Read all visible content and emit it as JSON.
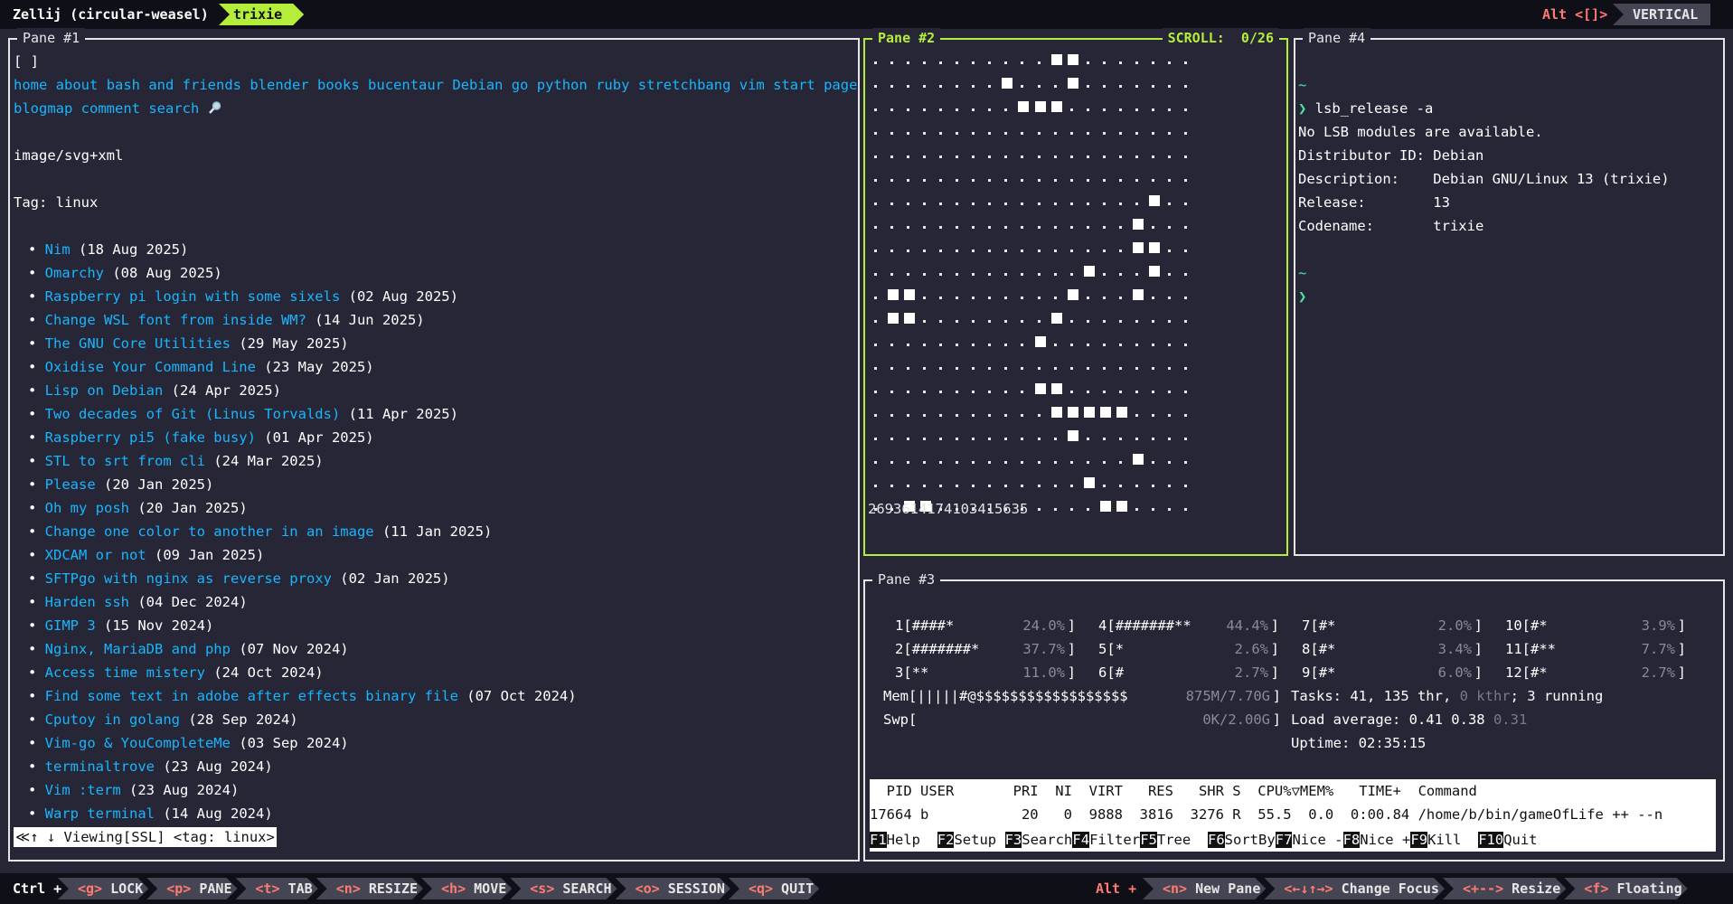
{
  "topbar": {
    "session": "Zellij (circular-weasel)",
    "tab": "trixie",
    "alt_hint": "Alt <[]>",
    "layout": "VERTICAL"
  },
  "panes": {
    "p1": {
      "title": "Pane #1"
    },
    "p2": {
      "title": "Pane #2",
      "scroll": "SCROLL:  0/26"
    },
    "p3": {
      "title": "Pane #3"
    },
    "p4": {
      "title": "Pane #4"
    }
  },
  "browser": {
    "top": "[ ]",
    "nav": [
      "home",
      "about",
      "bash and friends",
      "blender",
      "books",
      "bucentaur",
      "Debian",
      "go",
      "python",
      "ruby",
      "stretchbang",
      "vim",
      "start page"
    ],
    "nav2": [
      "blogmap",
      "comment",
      "search"
    ],
    "search_icon": "magnifier-icon",
    "mime": "image/svg+xml",
    "tag": "Tag: linux",
    "posts": [
      {
        "title": "Nim",
        "date": " (18 Aug 2025)"
      },
      {
        "title": "Omarchy",
        "date": " (08 Aug 2025)"
      },
      {
        "title": "Raspberry pi login with some sixels",
        "date": " (02 Aug 2025)"
      },
      {
        "title": "Change WSL font from inside WM?",
        "date": " (14 Jun 2025)"
      },
      {
        "title": "The GNU Core Utilities",
        "date": " (29 May 2025)"
      },
      {
        "title": "Oxidise Your Command Line",
        "date": " (23 May 2025)"
      },
      {
        "title": "Lisp on Debian",
        "date": " (24 Apr 2025)"
      },
      {
        "title": "Two decades of Git (Linus Torvalds)",
        "date": " (11 Apr 2025)"
      },
      {
        "title": "Raspberry pi5 (fake busy)",
        "date": " (01 Apr 2025)"
      },
      {
        "title": "STL to srt from cli",
        "date": " (24 Mar 2025)"
      },
      {
        "title": "Please",
        "date": " (20 Jan 2025)"
      },
      {
        "title": "Oh my posh",
        "date": " (20 Jan 2025)"
      },
      {
        "title": "Change one color to another in an image",
        "date": " (11 Jan 2025)"
      },
      {
        "title": "XDCAM or not",
        "date": " (09 Jan 2025)"
      },
      {
        "title": "SFTPgo with nginx as reverse proxy",
        "date": " (02 Jan 2025)"
      },
      {
        "title": "Harden ssh",
        "date": " (04 Dec 2024)"
      },
      {
        "title": "GIMP 3",
        "date": " (15 Nov 2024)"
      },
      {
        "title": "Nginx, MariaDB and php",
        "date": " (07 Nov 2024)"
      },
      {
        "title": "Access time mistery",
        "date": " (24 Oct 2024)"
      },
      {
        "title": "Find some text in adobe after effects binary file",
        "date": " (07 Oct 2024)"
      },
      {
        "title": "Cputoy in golang",
        "date": " (28 Sep 2024)"
      },
      {
        "title": "Vim-go & YouCompleteMe",
        "date": " (03 Sep 2024)"
      },
      {
        "title": "terminaltrove",
        "date": " (23 Aug 2024)"
      },
      {
        "title": "Vim :term",
        "date": " (23 Aug 2024)"
      },
      {
        "title": "Warp terminal",
        "date": " (14 Aug 2024)"
      }
    ],
    "status": "≪↑ ↓ Viewing[SSL] <tag: linux>"
  },
  "life": {
    "cols": 20,
    "rows": 19,
    "alive": [
      [
        11,
        12
      ],
      [
        8,
        12
      ],
      [
        9,
        10,
        11
      ],
      [],
      [],
      [],
      [
        17
      ],
      [
        16
      ],
      [
        16,
        17
      ],
      [
        13,
        17
      ],
      [
        1,
        2,
        12,
        16
      ],
      [
        1,
        2,
        11
      ],
      [
        10
      ],
      [],
      [
        10,
        11
      ],
      [
        11,
        12,
        13,
        14,
        15
      ],
      [
        12
      ],
      [
        16
      ],
      [
        13
      ],
      [
        2,
        3,
        14,
        15
      ]
    ],
    "counter": "2693614174103415635"
  },
  "htop": {
    "cpus": [
      {
        "id": "1",
        "bar": "####*",
        "pct": "24.0%"
      },
      {
        "id": "2",
        "bar": "#######*",
        "pct": "37.7%"
      },
      {
        "id": "3",
        "bar": "**",
        "pct": "11.0%"
      },
      {
        "id": "4",
        "bar": "#######**",
        "pct": "44.4%"
      },
      {
        "id": "5",
        "bar": "*",
        "pct": "2.6%"
      },
      {
        "id": "6",
        "bar": "#",
        "pct": "2.7%"
      },
      {
        "id": "7",
        "bar": "#*",
        "pct": "2.0%"
      },
      {
        "id": "8",
        "bar": "#*",
        "pct": "3.4%"
      },
      {
        "id": "9",
        "bar": "#*",
        "pct": "6.0%"
      },
      {
        "id": "10",
        "bar": "#*",
        "pct": "3.9%"
      },
      {
        "id": "11",
        "bar": "#**",
        "pct": "7.7%"
      },
      {
        "id": "12",
        "bar": "#*",
        "pct": "2.7%"
      }
    ],
    "mem_label": "Mem",
    "mem_bar": "|||||#@$$$$$$$$$$$$$$$$$$",
    "mem_val": "875M/7.70G",
    "swp_label": "Swp",
    "swp_val": "0K/2.00G",
    "tasks": "Tasks: 41, 135 thr, ",
    "kthr": "0 kthr",
    "running": "; 3 running",
    "load": "Load average: 0.41 0.38 ",
    "load3": "0.31",
    "uptime": "Uptime: 02:35:15",
    "header": "  PID USER       PRI  NI  VIRT   RES   SHR S  CPU%▽MEM%   TIME+  Command",
    "row": "17664 b           20   0  9888  3816  3276 R  55.5  0.0  0:00.84 /home/b/bin/gameOfLife ++ --n",
    "fkeys": [
      {
        "n": "F1",
        "l": "Help  "
      },
      {
        "n": "F2",
        "l": "Setup "
      },
      {
        "n": "F3",
        "l": "Search"
      },
      {
        "n": "F4",
        "l": "Filter"
      },
      {
        "n": "F5",
        "l": "Tree  "
      },
      {
        "n": "F6",
        "l": "SortBy"
      },
      {
        "n": "F7",
        "l": "Nice -"
      },
      {
        "n": "F8",
        "l": "Nice +"
      },
      {
        "n": "F9",
        "l": "Kill  "
      },
      {
        "n": "F10",
        "l": "Quit"
      }
    ]
  },
  "shell": {
    "tilde": "~",
    "prompt": "❯",
    "cmd": "lsb_release -a",
    "out": [
      "No LSB modules are available.",
      "Distributor ID: Debian",
      "Description:    Debian GNU/Linux 13 (trixie)",
      "Release:        13",
      "Codename:       trixie"
    ]
  },
  "bottombar": {
    "ctrl": "Ctrl +",
    "left": [
      {
        "k": "<g>",
        "l": " LOCK"
      },
      {
        "k": "<p>",
        "l": " PANE"
      },
      {
        "k": "<t>",
        "l": " TAB"
      },
      {
        "k": "<n>",
        "l": " RESIZE"
      },
      {
        "k": "<h>",
        "l": " MOVE"
      },
      {
        "k": "<s>",
        "l": " SEARCH"
      },
      {
        "k": "<o>",
        "l": " SESSION"
      },
      {
        "k": "<q>",
        "l": " QUIT"
      }
    ],
    "alt": "Alt +",
    "right": [
      {
        "k": "<n>",
        "l": " New Pane"
      },
      {
        "k": "<←↓↑→>",
        "l": " Change Focus"
      },
      {
        "k": "<+-->",
        "l": " Resize"
      },
      {
        "k": "<f>",
        "l": " Floating"
      }
    ]
  },
  "colors": {
    "accent": "#b5ee3a",
    "link": "#17b6ff",
    "bg": "#262637",
    "bar": "#0f0f18",
    "keyhint": "#ff7b72"
  }
}
